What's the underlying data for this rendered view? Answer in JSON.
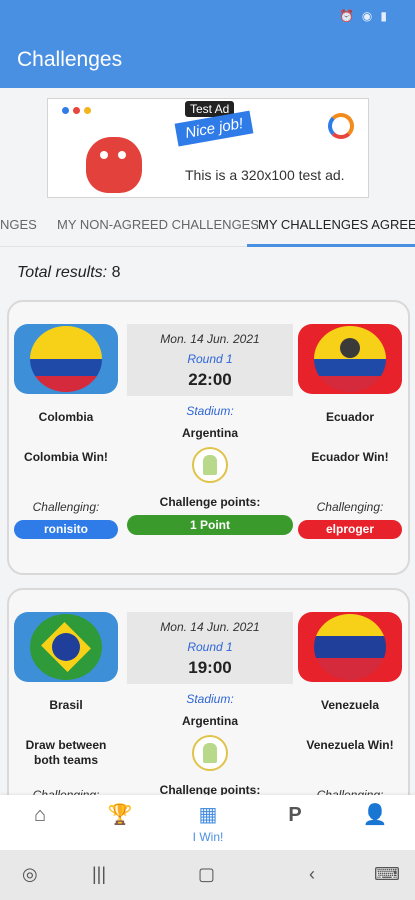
{
  "app": {
    "title": "Challenges"
  },
  "status_bar": {
    "icons": [
      "alarm-icon",
      "wifi-icon",
      "signal-icon"
    ]
  },
  "ad": {
    "tag": "Test Ad",
    "banner": "Nice job!",
    "text": "This is a 320x100 test ad."
  },
  "tabs": [
    {
      "label": "NGES"
    },
    {
      "label": "MY NON-AGREED CHALLENGES"
    },
    {
      "label": "MY CHALLENGES AGREED",
      "active": true
    }
  ],
  "total": {
    "label": "Total results:",
    "value": "8"
  },
  "challenges": [
    {
      "date": "Mon. 14 Jun. 2021",
      "round": "Round 1",
      "time": "22:00",
      "stadium_label": "Stadium:",
      "stadium": "Argentina",
      "points_label": "Challenge points:",
      "points": "1 Point",
      "home": {
        "name": "Colombia",
        "prediction": "Colombia Win!",
        "challenging_label": "Challenging:",
        "user": "ronisito",
        "user_color": "#2f7be8"
      },
      "away": {
        "name": "Ecuador",
        "prediction": "Ecuador Win!",
        "challenging_label": "Challenging:",
        "user": "elproger",
        "user_color": "#e8222a"
      }
    },
    {
      "date": "Mon. 14 Jun. 2021",
      "round": "Round 1",
      "time": "19:00",
      "stadium_label": "Stadium:",
      "stadium": "Argentina",
      "points_label": "Challenge points:",
      "home": {
        "name": "Brasil",
        "prediction": "Draw between both teams",
        "challenging_label": "Challenging:"
      },
      "away": {
        "name": "Venezuela",
        "prediction": "Venezuela Win!",
        "challenging_label": "Challenging:"
      }
    }
  ],
  "bottom_nav": [
    {
      "icon": "home-icon"
    },
    {
      "icon": "trophy-icon"
    },
    {
      "icon": "grid-icon",
      "label": "I Win!",
      "active": true
    },
    {
      "icon": "p-icon",
      "glyph": "P"
    },
    {
      "icon": "person-icon"
    }
  ],
  "colors": {
    "primary": "#4a90e2",
    "points_green": "#3a9a2c",
    "home_user": "#2f7be8",
    "away_user": "#e8222a"
  }
}
